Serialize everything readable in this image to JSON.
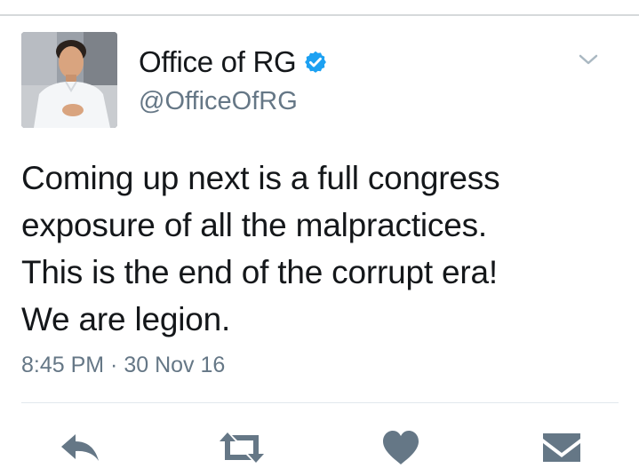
{
  "tweet": {
    "display_name": "Office of RG",
    "handle": "@OfficeOfRG",
    "text": "Coming up next is a full congress\nexposure of all the malpractices.\nThis is the end of the corrupt era!\nWe are legion.",
    "timestamp": "8:45 PM · 30 Nov 16",
    "verified": true
  },
  "icons": {
    "verified": "verified-badge-icon",
    "menu": "chevron-down-icon",
    "reply": "reply-icon",
    "retweet": "retweet-icon",
    "like": "heart-icon",
    "message": "envelope-icon"
  },
  "colors": {
    "text": "#14171a",
    "secondary": "#657786",
    "verified_blue": "#1da1f2",
    "action_icon": "#657786",
    "divider": "#e1e8ed"
  }
}
